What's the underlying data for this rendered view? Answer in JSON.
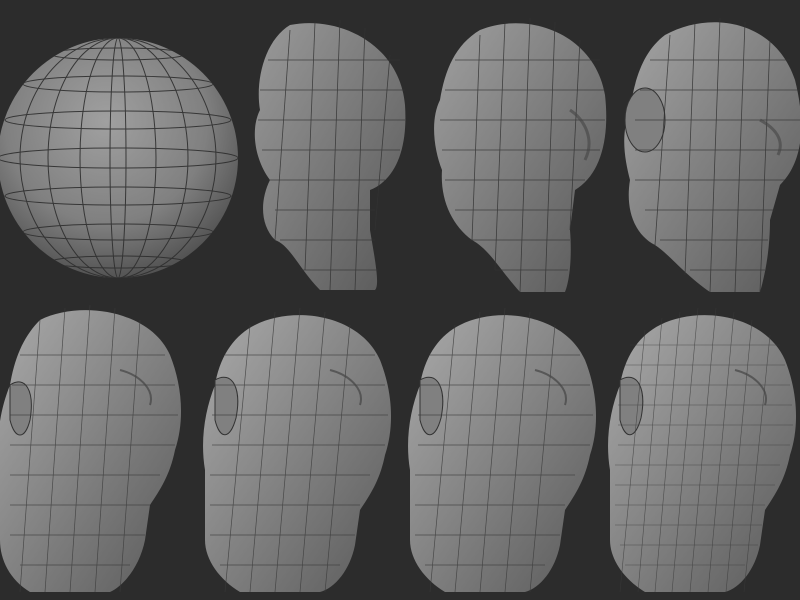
{
  "scene": {
    "background_color": "#2c2c2c",
    "model_color": "#8c8c8c",
    "model_shadow_color": "#3a3a3a",
    "wire_color": "#2a2a2a"
  },
  "stages": [
    {
      "name": "base-sphere"
    },
    {
      "name": "rough-blockout"
    },
    {
      "name": "blockout-with-features"
    },
    {
      "name": "rough-head-with-ears"
    },
    {
      "name": "detailed-head"
    },
    {
      "name": "detailed-head"
    },
    {
      "name": "detailed-head"
    },
    {
      "name": "detailed-head"
    }
  ]
}
